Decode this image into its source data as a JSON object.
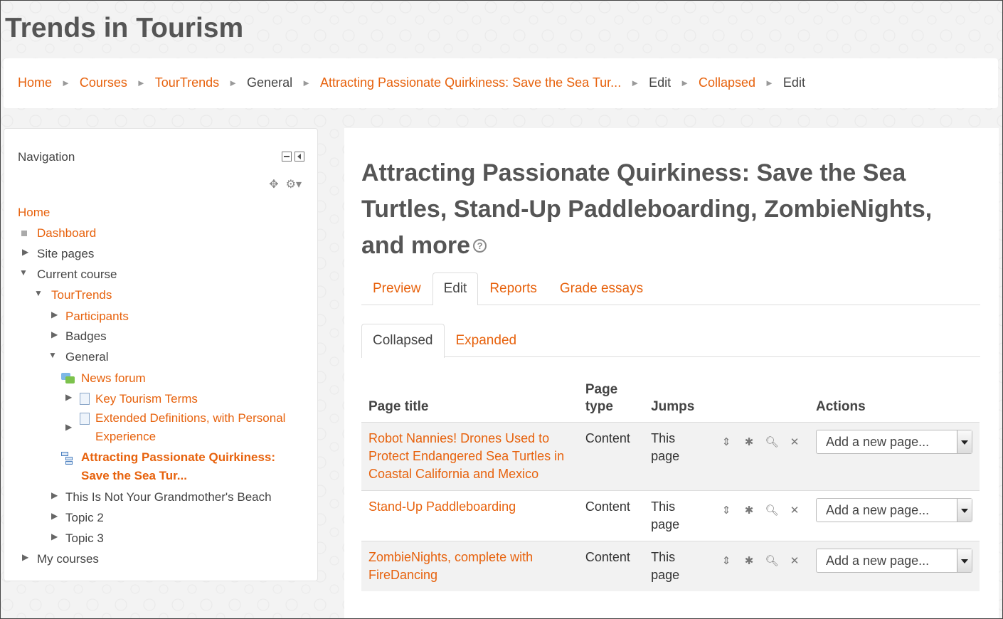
{
  "site_title": "Trends in Tourism",
  "breadcrumb": [
    {
      "label": "Home",
      "link": true
    },
    {
      "label": "Courses",
      "link": true
    },
    {
      "label": "TourTrends",
      "link": true
    },
    {
      "label": "General",
      "link": false
    },
    {
      "label": "Attracting Passionate Quirkiness: Save the Sea Tur...",
      "link": true
    },
    {
      "label": "Edit",
      "link": false
    },
    {
      "label": "Collapsed",
      "link": true
    },
    {
      "label": "Edit",
      "link": false
    }
  ],
  "navigation": {
    "title": "Navigation",
    "items": {
      "home": "Home",
      "dashboard": "Dashboard",
      "site_pages": "Site pages",
      "current_course": "Current course",
      "tourtrends": "TourTrends",
      "participants": "Participants",
      "badges": "Badges",
      "general": "General",
      "news_forum": "News forum",
      "key_terms": "Key Tourism Terms",
      "extended_defs_1": "Extended Definitions, with Personal",
      "extended_defs_2": "Experience",
      "attracting_1": "Attracting Passionate Quirkiness:",
      "attracting_2": "Save the Sea Tur...",
      "grandmother": "This Is Not Your Grandmother's Beach",
      "topic2": "Topic 2",
      "topic3": "Topic 3",
      "my_courses": "My courses"
    }
  },
  "main": {
    "heading": "Attracting Passionate Quirkiness: Save the Sea Turtles, Stand-Up Paddleboarding, ZombieNights, and more",
    "tabs": [
      "Preview",
      "Edit",
      "Reports",
      "Grade essays"
    ],
    "active_tab": "Edit",
    "subtabs": [
      "Collapsed",
      "Expanded"
    ],
    "active_subtab": "Collapsed",
    "table": {
      "headers": {
        "title": "Page title",
        "type_1": "Page",
        "type_2": "type",
        "jumps": "Jumps",
        "actions": "Actions"
      },
      "rows": [
        {
          "title_1": "Robot Nannies! Drones Used to",
          "title_2": "Protect Endangered Sea Turtles in",
          "title_3": "Coastal California and Mexico",
          "type": "Content",
          "jumps_1": "This",
          "jumps_2": "page",
          "select": "Add a new page..."
        },
        {
          "title_1": "Stand-Up Paddleboarding",
          "title_2": "",
          "title_3": "",
          "type": "Content",
          "jumps_1": "This",
          "jumps_2": "page",
          "select": "Add a new page..."
        },
        {
          "title_1": "ZombieNights, complete with",
          "title_2": "FireDancing",
          "title_3": "",
          "type": "Content",
          "jumps_1": "This",
          "jumps_2": "page",
          "select": "Add a new page..."
        }
      ]
    }
  },
  "colors": {
    "link": "#e7620d",
    "heading": "#555555"
  }
}
